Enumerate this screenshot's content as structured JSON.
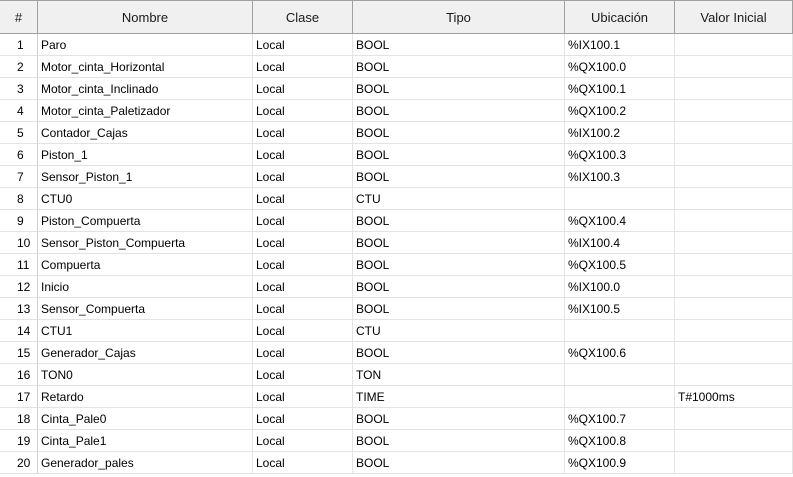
{
  "columns": [
    "#",
    "Nombre",
    "Clase",
    "Tipo",
    "Ubicación",
    "Valor Inicial"
  ],
  "rows": [
    {
      "num": "1",
      "nombre": "Paro",
      "clase": "Local",
      "tipo": "BOOL",
      "ubicacion": "%IX100.1",
      "valor": ""
    },
    {
      "num": "2",
      "nombre": "Motor_cinta_Horizontal",
      "clase": "Local",
      "tipo": "BOOL",
      "ubicacion": "%QX100.0",
      "valor": ""
    },
    {
      "num": "3",
      "nombre": "Motor_cinta_Inclinado",
      "clase": "Local",
      "tipo": "BOOL",
      "ubicacion": "%QX100.1",
      "valor": ""
    },
    {
      "num": "4",
      "nombre": "Motor_cinta_Paletizador",
      "clase": "Local",
      "tipo": "BOOL",
      "ubicacion": "%QX100.2",
      "valor": ""
    },
    {
      "num": "5",
      "nombre": "Contador_Cajas",
      "clase": "Local",
      "tipo": "BOOL",
      "ubicacion": "%IX100.2",
      "valor": ""
    },
    {
      "num": "6",
      "nombre": "Piston_1",
      "clase": "Local",
      "tipo": "BOOL",
      "ubicacion": "%QX100.3",
      "valor": ""
    },
    {
      "num": "7",
      "nombre": "Sensor_Piston_1",
      "clase": "Local",
      "tipo": "BOOL",
      "ubicacion": "%IX100.3",
      "valor": ""
    },
    {
      "num": "8",
      "nombre": "CTU0",
      "clase": "Local",
      "tipo": "CTU",
      "ubicacion": "",
      "valor": ""
    },
    {
      "num": "9",
      "nombre": "Piston_Compuerta",
      "clase": "Local",
      "tipo": "BOOL",
      "ubicacion": "%QX100.4",
      "valor": ""
    },
    {
      "num": "10",
      "nombre": "Sensor_Piston_Compuerta",
      "clase": "Local",
      "tipo": "BOOL",
      "ubicacion": "%IX100.4",
      "valor": ""
    },
    {
      "num": "11",
      "nombre": "Compuerta",
      "clase": "Local",
      "tipo": "BOOL",
      "ubicacion": "%QX100.5",
      "valor": ""
    },
    {
      "num": "12",
      "nombre": "Inicio",
      "clase": "Local",
      "tipo": "BOOL",
      "ubicacion": "%IX100.0",
      "valor": ""
    },
    {
      "num": "13",
      "nombre": "Sensor_Compuerta",
      "clase": "Local",
      "tipo": "BOOL",
      "ubicacion": "%IX100.5",
      "valor": ""
    },
    {
      "num": "14",
      "nombre": "CTU1",
      "clase": "Local",
      "tipo": "CTU",
      "ubicacion": "",
      "valor": ""
    },
    {
      "num": "15",
      "nombre": "Generador_Cajas",
      "clase": "Local",
      "tipo": "BOOL",
      "ubicacion": "%QX100.6",
      "valor": ""
    },
    {
      "num": "16",
      "nombre": "TON0",
      "clase": "Local",
      "tipo": "TON",
      "ubicacion": "",
      "valor": ""
    },
    {
      "num": "17",
      "nombre": "Retardo",
      "clase": "Local",
      "tipo": "TIME",
      "ubicacion": "",
      "valor": "T#1000ms"
    },
    {
      "num": "18",
      "nombre": "Cinta_Pale0",
      "clase": "Local",
      "tipo": "BOOL",
      "ubicacion": "%QX100.7",
      "valor": ""
    },
    {
      "num": "19",
      "nombre": "Cinta_Pale1",
      "clase": "Local",
      "tipo": "BOOL",
      "ubicacion": "%QX100.8",
      "valor": ""
    },
    {
      "num": "20",
      "nombre": "Generador_pales",
      "clase": "Local",
      "tipo": "BOOL",
      "ubicacion": "%QX100.9",
      "valor": ""
    }
  ]
}
